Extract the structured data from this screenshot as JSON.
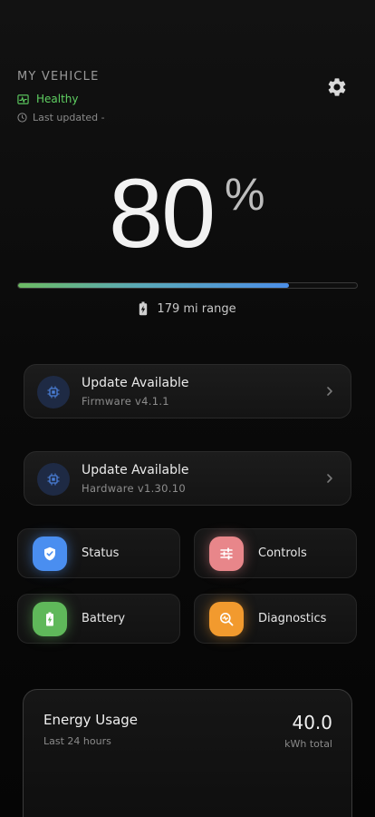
{
  "header": {
    "title": "MY VEHICLE",
    "health": "Healthy",
    "last_updated": "Last updated -"
  },
  "battery": {
    "percent": "80",
    "percent_sign": "%",
    "level_fraction": 0.8,
    "range": "179 mi range"
  },
  "updates": [
    {
      "title": "Update Available",
      "subtitle": "Firmware v4.1.1"
    },
    {
      "title": "Update Available",
      "subtitle": "Hardware v1.30.10"
    }
  ],
  "tiles": [
    {
      "label": "Status",
      "icon": "shield-icon",
      "color": "#4a8ef0"
    },
    {
      "label": "Controls",
      "icon": "sliders-icon",
      "color": "#e8868a"
    },
    {
      "label": "Battery",
      "icon": "battery-charging-icon",
      "color": "#5fb85a"
    },
    {
      "label": "Diagnostics",
      "icon": "magnify-pulse-icon",
      "color": "#f29a2e"
    }
  ],
  "energy": {
    "title": "Energy Usage",
    "subtitle": "Last 24 hours",
    "value": "40.0",
    "unit": "kWh total"
  },
  "colors": {
    "healthy": "#5fcf62",
    "bar_start": "#6dbb63",
    "bar_end": "#4c8fe8",
    "chip_bg": "#1e2a44",
    "chip_fg": "#4a7fd8"
  }
}
